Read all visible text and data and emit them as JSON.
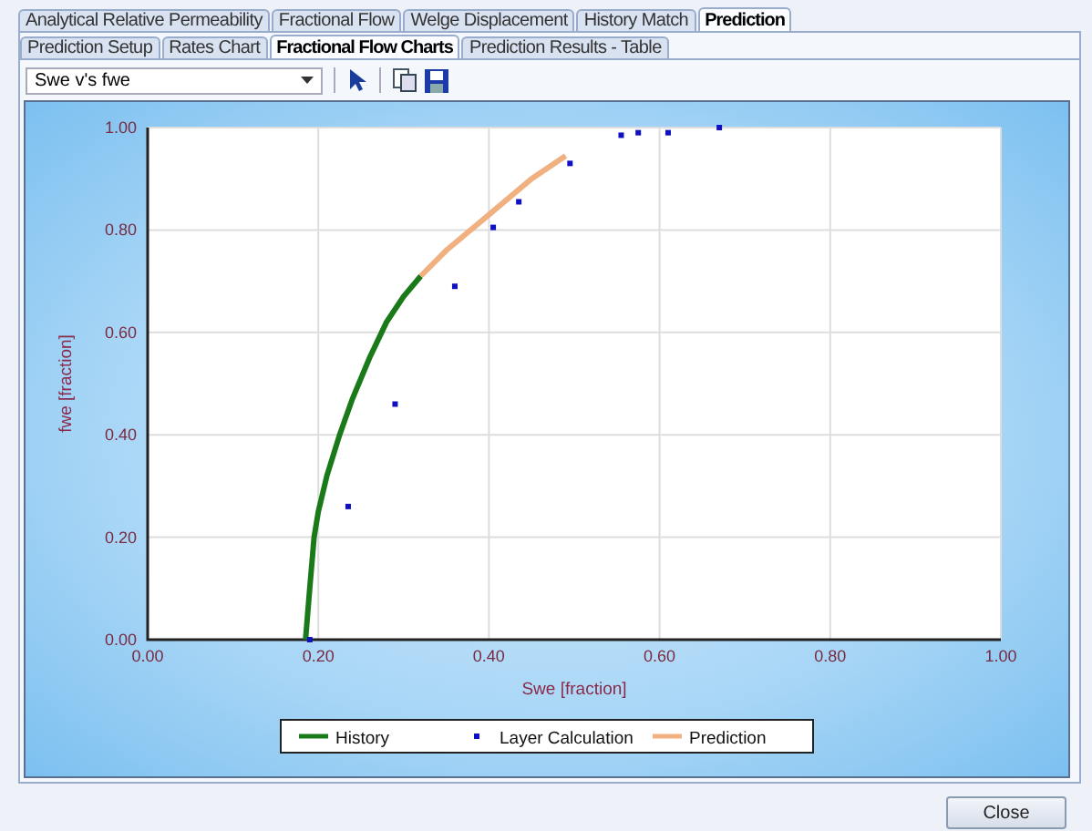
{
  "main_tabs": [
    {
      "label": "Analytical Relative Permeability",
      "selected": false
    },
    {
      "label": "Fractional Flow",
      "selected": false
    },
    {
      "label": "Welge Displacement",
      "selected": false
    },
    {
      "label": "History Match",
      "selected": false
    },
    {
      "label": "Prediction",
      "selected": true
    }
  ],
  "sub_tabs": [
    {
      "label": "Prediction Setup",
      "selected": false
    },
    {
      "label": "Rates Chart",
      "selected": false
    },
    {
      "label": "Fractional Flow Charts",
      "selected": true
    },
    {
      "label": "Prediction Results - Table",
      "selected": false
    }
  ],
  "chart_selector": {
    "value": "Swe v's fwe"
  },
  "chart": {
    "chart_data": {
      "type": "line",
      "grid": true,
      "legend": true,
      "xlabel": "Swe [fraction]",
      "ylabel": "fwe [fraction]",
      "xlim": [
        0,
        1
      ],
      "ylim": [
        0,
        1
      ],
      "xticks": [
        {
          "value": 0,
          "label": "0.00"
        },
        {
          "value": 0.2,
          "label": "0.20"
        },
        {
          "value": 0.4,
          "label": "0.40"
        },
        {
          "value": 0.6,
          "label": "0.60"
        },
        {
          "value": 0.8,
          "label": "0.80"
        },
        {
          "value": 1,
          "label": "1.00"
        }
      ],
      "yticks": [
        {
          "value": 0,
          "label": "0.00"
        },
        {
          "value": 0.2,
          "label": "0.20"
        },
        {
          "value": 0.4,
          "label": "0.40"
        },
        {
          "value": 0.6,
          "label": "0.60"
        },
        {
          "value": 0.8,
          "label": "0.80"
        },
        {
          "value": 1,
          "label": "1.00"
        }
      ],
      "x": [
        0.185,
        0.19,
        0.195,
        0.2,
        0.21,
        0.225,
        0.24,
        0.26,
        0.28,
        0.3,
        0.32,
        0.35,
        0.4,
        0.45,
        0.49
      ],
      "series": [
        {
          "name": "History",
          "color": "#1a7a1a",
          "type": "line",
          "values": [
            0,
            0.1,
            0.2,
            0.25,
            0.32,
            0.4,
            0.47,
            0.55,
            0.62,
            0.67,
            0.71,
            null,
            null,
            null,
            null
          ]
        },
        {
          "name": "Layer Calculation",
          "color": "#1010c0",
          "type": "scatter",
          "x": [
            0.19,
            0.235,
            0.29,
            0.36,
            0.405,
            0.435,
            0.495,
            0.555,
            0.575,
            0.61,
            0.67
          ],
          "values": [
            0,
            0.26,
            0.46,
            0.69,
            0.805,
            0.855,
            0.93,
            0.985,
            0.99,
            0.99,
            1.0
          ]
        },
        {
          "name": "Prediction",
          "color": "#f0b080",
          "type": "line",
          "values": [
            null,
            null,
            null,
            null,
            null,
            null,
            null,
            null,
            null,
            null,
            0.71,
            0.76,
            0.83,
            0.9,
            0.945
          ]
        }
      ]
    }
  },
  "buttons": [
    {
      "label": "Close"
    }
  ]
}
